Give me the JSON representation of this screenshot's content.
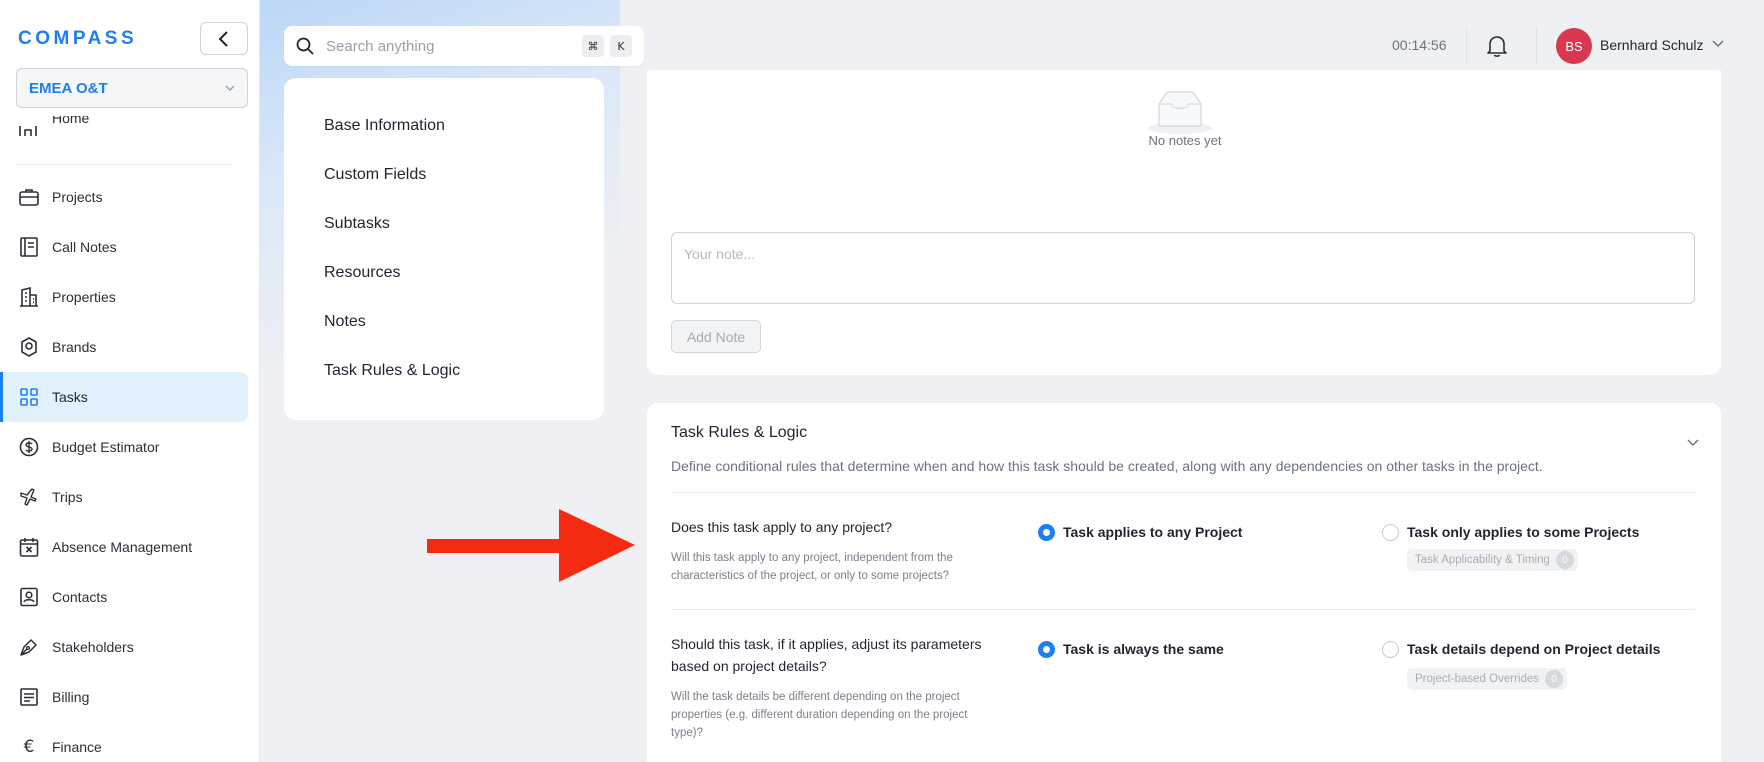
{
  "app": {
    "logo": "COMPASS",
    "org_select": "EMEA O&T"
  },
  "sidebar": {
    "home_label": "Home",
    "items": [
      {
        "label": "Projects",
        "icon": "briefcase-icon",
        "active": false
      },
      {
        "label": "Call Notes",
        "icon": "notebook-icon",
        "active": false
      },
      {
        "label": "Properties",
        "icon": "building-icon",
        "active": false
      },
      {
        "label": "Brands",
        "icon": "badge-icon",
        "active": false
      },
      {
        "label": "Tasks",
        "icon": "grid-icon",
        "active": true
      },
      {
        "label": "Budget Estimator",
        "icon": "dollar-icon",
        "active": false
      },
      {
        "label": "Trips",
        "icon": "plane-icon",
        "active": false
      },
      {
        "label": "Absence Management",
        "icon": "calendar-x-icon",
        "active": false
      },
      {
        "label": "Contacts",
        "icon": "contact-card-icon",
        "active": false
      },
      {
        "label": "Stakeholders",
        "icon": "pen-nib-icon",
        "active": false
      },
      {
        "label": "Billing",
        "icon": "receipt-icon",
        "active": false
      },
      {
        "label": "Finance",
        "icon": "euro-icon",
        "active": false
      }
    ]
  },
  "header": {
    "search_placeholder": "Search anything",
    "shortcut_keys": [
      "⌘",
      "K"
    ],
    "timer": "00:14:56",
    "user_initials": "BS",
    "user_name": "Bernhard Schulz"
  },
  "section_nav": {
    "items": [
      "Base Information",
      "Custom Fields",
      "Subtasks",
      "Resources",
      "Notes",
      "Task Rules & Logic"
    ]
  },
  "notes": {
    "empty_text": "No notes yet",
    "input_placeholder": "Your note...",
    "add_button": "Add Note"
  },
  "rules": {
    "title": "Task Rules & Logic",
    "description": "Define conditional rules that determine when and how this task should be created, along with any dependencies on other tasks in the project.",
    "questions": [
      {
        "title": "Does this task apply to any project?",
        "description": "Will this task apply to any project, independent from the characteristics of the project, or only to some projects?",
        "option_a": "Task applies to any Project",
        "option_b": "Task only applies to some Projects",
        "chip_label": "Task Applicability & Timing",
        "chip_count": "0",
        "selected": "a"
      },
      {
        "title": "Should this task, if it applies, adjust its parameters based on project details?",
        "description": "Will the task details be different depending on the project properties (e.g. different duration depending on the project type)?",
        "option_a": "Task is always the same",
        "option_b": "Task details depend on Project details",
        "chip_label": "Project-based Overrides",
        "chip_count": "0",
        "selected": "a"
      }
    ]
  },
  "colors": {
    "accent": "#1d7ff0",
    "annotation_arrow": "#f52a12",
    "avatar": "#d9364f"
  }
}
